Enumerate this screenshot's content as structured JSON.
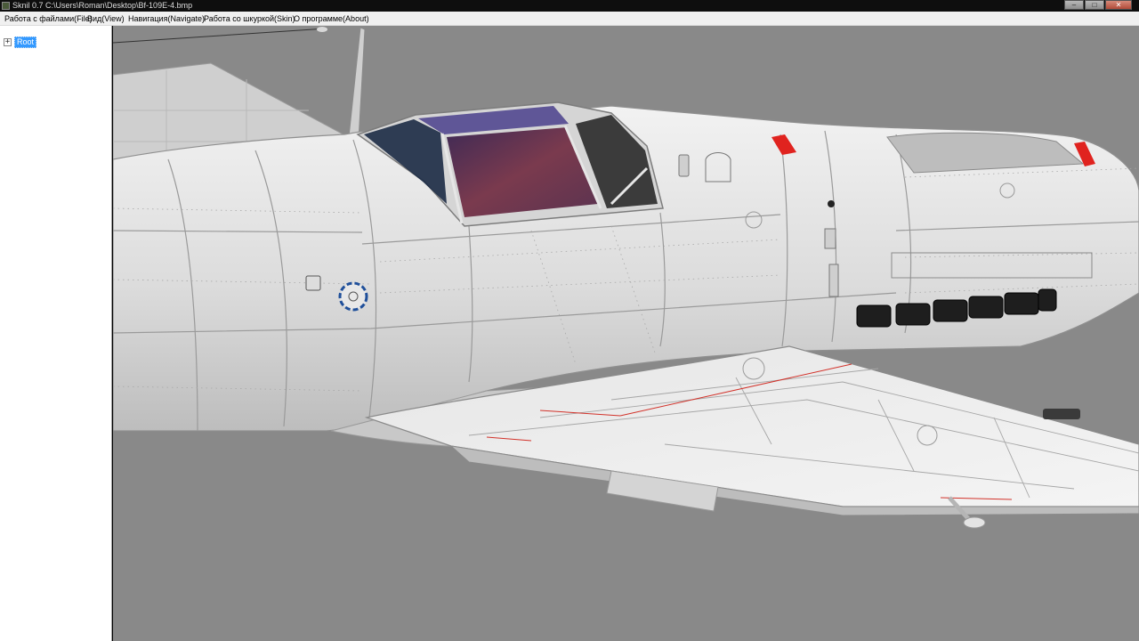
{
  "window": {
    "title": "Sknil 0.7   C:\\Users\\Roman\\Desktop\\Bf-109E-4.bmp",
    "minimize_glyph": "–",
    "maximize_glyph": "□",
    "close_glyph": "✕"
  },
  "menu": {
    "items": [
      {
        "label": "Работа с файлами(File)"
      },
      {
        "label": "Вид(View)"
      },
      {
        "label": "Навигация(Navigate)"
      },
      {
        "label": "Работа со шкуркой(Skin)"
      },
      {
        "label": "О программе(About)"
      }
    ]
  },
  "tree": {
    "expander": "+",
    "root_label": "Root"
  },
  "viewport": {
    "background": "#898989",
    "fuselage_color": "#dedede",
    "accent_red": "#e0231f",
    "roundel_blue": "#1f4f9a",
    "canopy_tint": "#6a2f55"
  }
}
